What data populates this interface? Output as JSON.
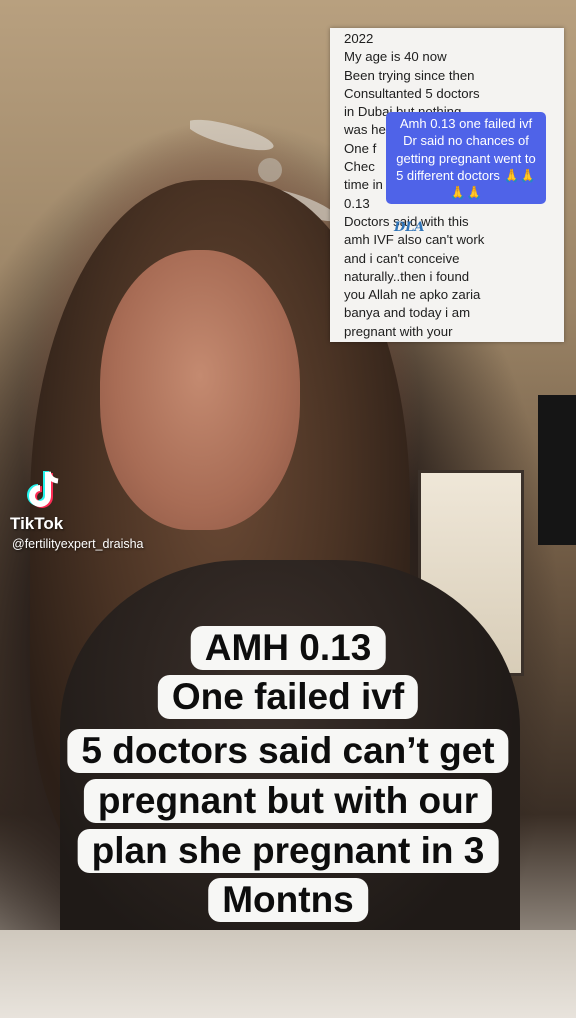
{
  "screenshot_note": {
    "lines": [
      "2022",
      "My age is 40 now",
      "Been trying since then",
      "Consultanted 5 doctors",
      "in Dubai but nothing",
      "was he",
      "One f",
      "Chec",
      "time in july and",
      "0.13",
      "Doctors said with this",
      "amh IVF also can't work",
      "and i can't conceive",
      "naturally..then i found",
      "you Allah ne apko zaria",
      "banya and today i am",
      "pregnant with your"
    ],
    "logo_text": "DLA",
    "banner_lines": [
      "Amh 0.13 one failed ivf",
      "Dr said no chances of",
      "getting pregnant went to",
      "5 different doctors"
    ],
    "banner_emoji": "🙏🙏"
  },
  "watermark": {
    "brand": "TikTok",
    "username": "@fertilityexpert_draisha"
  },
  "caption": {
    "lines": [
      "AMH 0.13",
      "One failed ivf",
      "5 doctors said can’t get",
      "pregnant but with our",
      "plan she pregnant in 3",
      "Montns"
    ]
  },
  "colors": {
    "banner": "#4f63e8",
    "caption_bg": "#f7f7f5",
    "logo": "#2f74b8"
  }
}
